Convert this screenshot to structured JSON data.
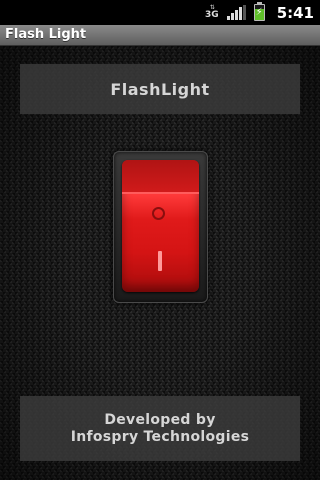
{
  "status_bar": {
    "network_type": "3G",
    "network_arrows": "⇅",
    "time": "5:41",
    "signal_level": 0.75,
    "battery_level": 0.75,
    "battery_charging_glyph": "⚡",
    "icons": [
      "network-3g-icon",
      "signal-icon",
      "battery-charging-icon"
    ]
  },
  "app": {
    "title": "Flash Light"
  },
  "main": {
    "header": "FlashLight",
    "switch": {
      "state": "off",
      "color": "#e01a1a"
    },
    "footer": {
      "line1": "Developed by",
      "line2": "Infospry Technologies"
    }
  },
  "colors": {
    "title_bar": "#747474",
    "panel": "#3c3c3c",
    "switch_red": "#e01a1a",
    "text_light": "#d6d6d6"
  }
}
